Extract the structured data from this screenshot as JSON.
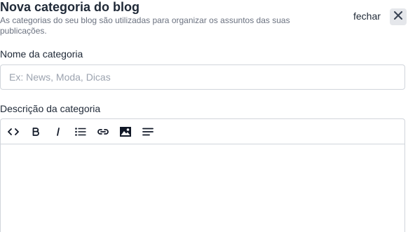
{
  "modal": {
    "title": "Nova categoria do blog",
    "subtitle": "As categorias do seu blog são utilizadas para organizar os assuntos das suas publicações.",
    "close_label": "fechar"
  },
  "form": {
    "name_label": "Nome da categoria",
    "name_placeholder": "Ex: News, Moda, Dicas",
    "name_value": "",
    "description_label": "Descrição da categoria",
    "description_value": ""
  },
  "toolbar": {
    "buttons": [
      {
        "icon": "code-icon"
      },
      {
        "icon": "bold-icon"
      },
      {
        "icon": "italic-icon"
      },
      {
        "icon": "bullet-list-icon"
      },
      {
        "icon": "link-icon"
      },
      {
        "icon": "image-icon"
      },
      {
        "icon": "align-left-icon"
      }
    ]
  }
}
